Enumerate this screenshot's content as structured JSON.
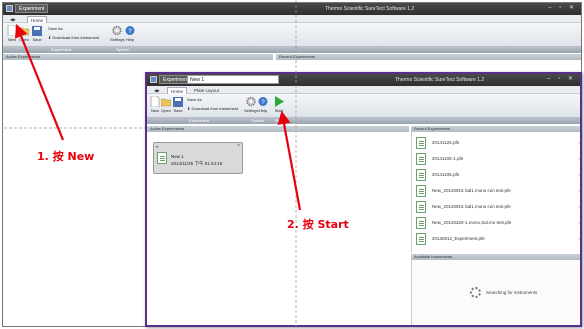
{
  "window1": {
    "doc_tab": "Experiment",
    "app_title": "Thermo Scientific SureTect Software 1.2",
    "tabs": [
      "Home"
    ],
    "ribbon": [
      "New",
      "Open",
      "Save",
      "Save As",
      "Download from instrument",
      "Settings",
      "Help"
    ],
    "groups": [
      "Experiment",
      "System"
    ],
    "panels": [
      "Active Experiments",
      "Recent Experiments"
    ]
  },
  "window2": {
    "doc_tab": "Experiment",
    "name_input": "New 1",
    "app_title": "Thermo Scientific SureTect Software 1.2",
    "tabs": [
      "Home",
      "Plate Layout"
    ],
    "ribbon": [
      "New",
      "Open",
      "Save",
      "Save As",
      "Download from instrument",
      "Settings",
      "Help",
      "Start"
    ],
    "groups": [
      "Experiment",
      "System",
      "Run"
    ],
    "active_panel": "Active Experiments",
    "card": {
      "title": "New 1",
      "date": "2014/11/25 下午 01:24:16"
    },
    "recent_panel": "Recent Experiments",
    "recent": [
      "20141125.pfe",
      "20141105-1.pfe",
      "20141105.pfe",
      "New_20140915 Sal1,mono con test.pfe",
      "New_20140915 Sal1,mono con test.pfe",
      "New_20140320-1,mono,Sal.mo test.pfe",
      "20130812_Experiment.pfe"
    ],
    "instruments_panel": "Available Instruments",
    "searching": "Searching for instruments"
  },
  "annotations": {
    "step1": "1. 按 New",
    "step2": "2. 按 Start",
    "color": "#e8000d"
  }
}
